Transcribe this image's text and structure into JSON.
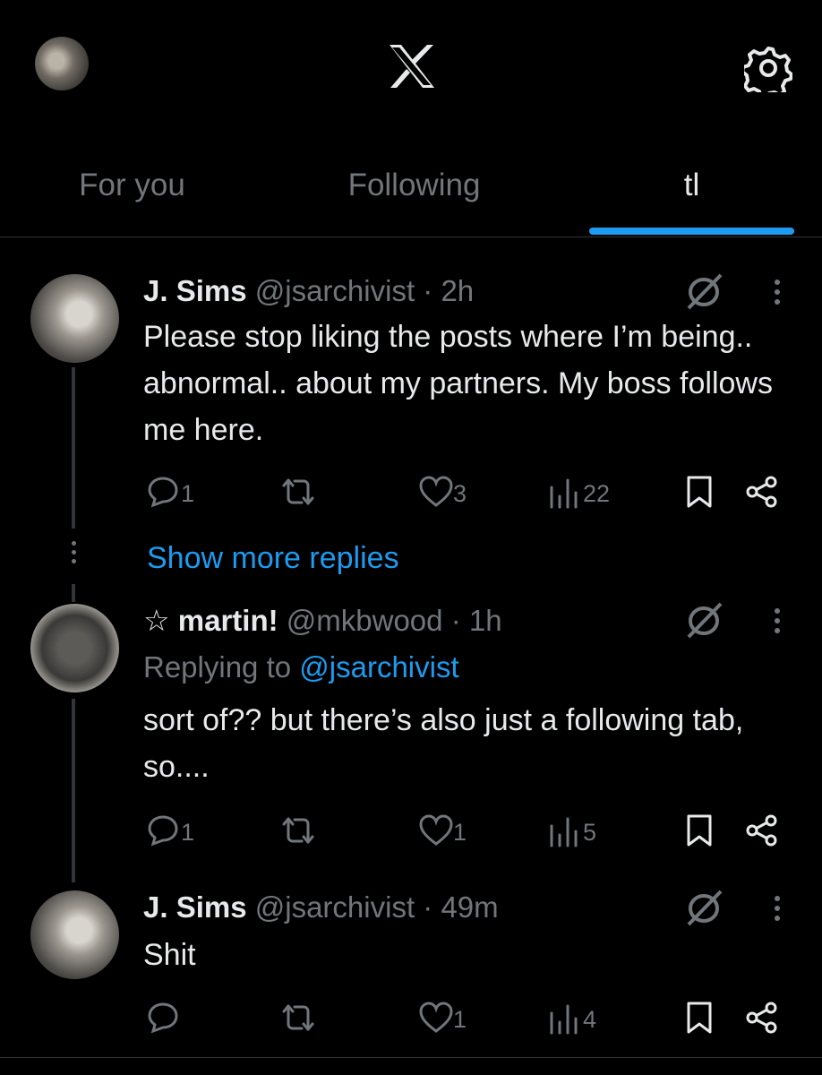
{
  "header": {
    "logo_icon": "x-logo-icon",
    "settings_icon": "gear-icon"
  },
  "tabs": [
    {
      "label": "For you",
      "active": false
    },
    {
      "label": "Following",
      "active": false
    },
    {
      "label": "tl",
      "active": true
    }
  ],
  "colors": {
    "background": "#000000",
    "text": "#e7e9ea",
    "muted": "#71767b",
    "accent": "#1d9bf0",
    "divider": "#2f3336"
  },
  "posts": [
    {
      "name": "J. Sims",
      "handle": "@jsarchivist",
      "time": "· 2h",
      "text": "Please stop liking the posts where I’m being.. abnormal.. about my partners. My boss follows me here.",
      "replies": "1",
      "likes": "3",
      "views": "22"
    },
    {
      "name": "☆ martin!",
      "handle": "@mkbwood",
      "time": "· 1h",
      "replying_prefix": "Replying to",
      "replying_to": "@jsarchivist",
      "text": "sort of?? but there’s also just a following tab, so....",
      "replies": "1",
      "likes": "1",
      "views": "5"
    },
    {
      "name": "J. Sims",
      "handle": "@jsarchivist",
      "time": "· 49m",
      "text": "Shit",
      "replies": "",
      "likes": "1",
      "views": "4"
    }
  ],
  "show_more": "Show more replies"
}
